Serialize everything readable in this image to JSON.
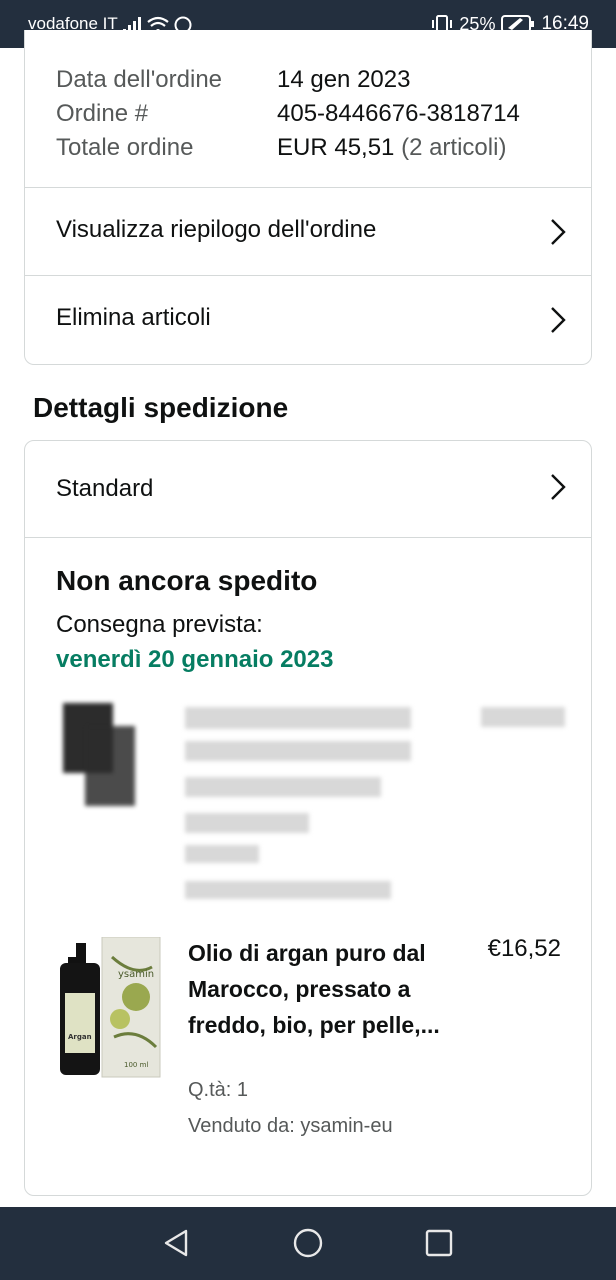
{
  "status_bar": {
    "carrier": "vodafone IT",
    "battery": "25%",
    "time": "16:49",
    "icons": [
      "signal-icon",
      "wifi-icon",
      "whatsapp-icon",
      "vibrate-icon",
      "battery-icon"
    ]
  },
  "order_info": {
    "date_label": "Data dell'ordine",
    "date_value": "14 gen 2023",
    "number_label": "Ordine #",
    "number_value": "405-8446676-3818714",
    "total_label": "Totale ordine",
    "total_value": "EUR 45,51",
    "total_items": "(2 articoli)"
  },
  "actions": {
    "summary": "Visualizza riepilogo dell'ordine",
    "delete": "Elimina articoli"
  },
  "shipping": {
    "section_title": "Dettagli spedizione",
    "method": "Standard",
    "status": "Non ancora spedito",
    "delivery_label": "Consegna prevista:",
    "delivery_date": "venerdì 20 gennaio 2023"
  },
  "product": {
    "title": "Olio di argan puro dal Marocco, pressato a freddo, bio, per pelle,...",
    "price": "€16,52",
    "qty": "Q.tà: 1",
    "seller": "Venduto da: ysamin-eu",
    "brand_label": "ysamin",
    "bottle_label": "Argan",
    "volume": "100 ml"
  },
  "colors": {
    "status_bar": "#232f3e",
    "delivery_green": "#067d62",
    "divider": "#d5d9d9"
  }
}
